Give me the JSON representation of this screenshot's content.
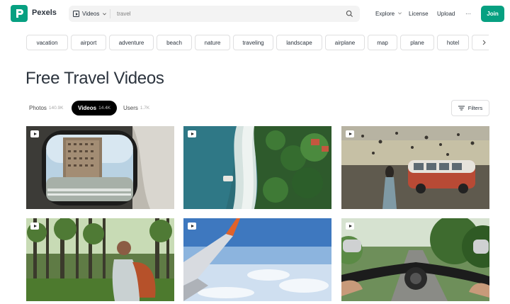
{
  "header": {
    "logo_text": "Pexels",
    "search_type": "Videos",
    "search_value": "travel",
    "nav": [
      "Explore",
      "License",
      "Upload",
      "···"
    ],
    "join_label": "Join"
  },
  "chips": [
    "vacation",
    "airport",
    "adventure",
    "beach",
    "nature",
    "traveling",
    "landscape",
    "airplane",
    "map",
    "plane",
    "hotel"
  ],
  "page": {
    "title": "Free Travel Videos"
  },
  "tabs": [
    {
      "label": "Photos",
      "count": "140.9K"
    },
    {
      "label": "Videos",
      "count": "14.4K"
    },
    {
      "label": "Users",
      "count": "1.7K"
    }
  ],
  "filters_label": "Filters",
  "colors": {
    "brand": "#07a081",
    "text": "#2c343e"
  }
}
